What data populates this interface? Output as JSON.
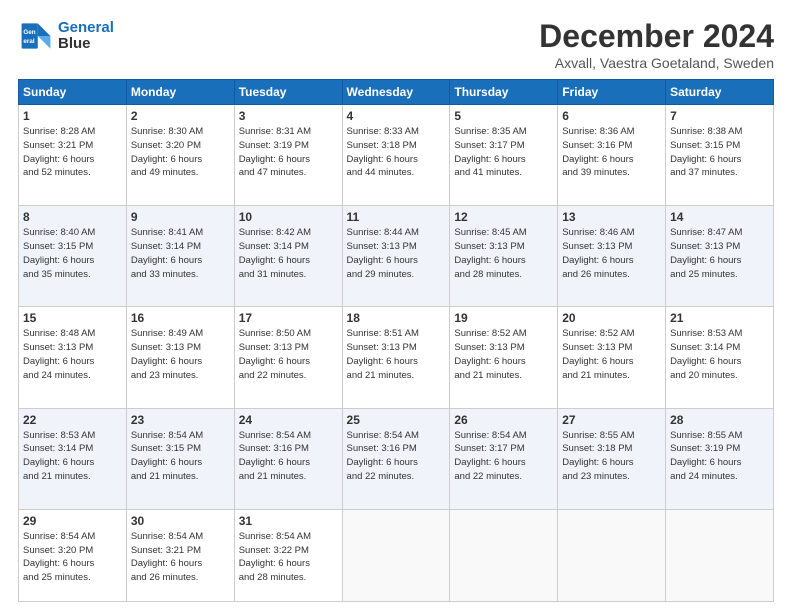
{
  "header": {
    "logo_line1": "General",
    "logo_line2": "Blue",
    "title": "December 2024",
    "subtitle": "Axvall, Vaestra Goetaland, Sweden"
  },
  "weekdays": [
    "Sunday",
    "Monday",
    "Tuesday",
    "Wednesday",
    "Thursday",
    "Friday",
    "Saturday"
  ],
  "weeks": [
    [
      {
        "day": "1",
        "lines": [
          "Sunrise: 8:28 AM",
          "Sunset: 3:21 PM",
          "Daylight: 6 hours",
          "and 52 minutes."
        ]
      },
      {
        "day": "2",
        "lines": [
          "Sunrise: 8:30 AM",
          "Sunset: 3:20 PM",
          "Daylight: 6 hours",
          "and 49 minutes."
        ]
      },
      {
        "day": "3",
        "lines": [
          "Sunrise: 8:31 AM",
          "Sunset: 3:19 PM",
          "Daylight: 6 hours",
          "and 47 minutes."
        ]
      },
      {
        "day": "4",
        "lines": [
          "Sunrise: 8:33 AM",
          "Sunset: 3:18 PM",
          "Daylight: 6 hours",
          "and 44 minutes."
        ]
      },
      {
        "day": "5",
        "lines": [
          "Sunrise: 8:35 AM",
          "Sunset: 3:17 PM",
          "Daylight: 6 hours",
          "and 41 minutes."
        ]
      },
      {
        "day": "6",
        "lines": [
          "Sunrise: 8:36 AM",
          "Sunset: 3:16 PM",
          "Daylight: 6 hours",
          "and 39 minutes."
        ]
      },
      {
        "day": "7",
        "lines": [
          "Sunrise: 8:38 AM",
          "Sunset: 3:15 PM",
          "Daylight: 6 hours",
          "and 37 minutes."
        ]
      }
    ],
    [
      {
        "day": "8",
        "lines": [
          "Sunrise: 8:40 AM",
          "Sunset: 3:15 PM",
          "Daylight: 6 hours",
          "and 35 minutes."
        ]
      },
      {
        "day": "9",
        "lines": [
          "Sunrise: 8:41 AM",
          "Sunset: 3:14 PM",
          "Daylight: 6 hours",
          "and 33 minutes."
        ]
      },
      {
        "day": "10",
        "lines": [
          "Sunrise: 8:42 AM",
          "Sunset: 3:14 PM",
          "Daylight: 6 hours",
          "and 31 minutes."
        ]
      },
      {
        "day": "11",
        "lines": [
          "Sunrise: 8:44 AM",
          "Sunset: 3:13 PM",
          "Daylight: 6 hours",
          "and 29 minutes."
        ]
      },
      {
        "day": "12",
        "lines": [
          "Sunrise: 8:45 AM",
          "Sunset: 3:13 PM",
          "Daylight: 6 hours",
          "and 28 minutes."
        ]
      },
      {
        "day": "13",
        "lines": [
          "Sunrise: 8:46 AM",
          "Sunset: 3:13 PM",
          "Daylight: 6 hours",
          "and 26 minutes."
        ]
      },
      {
        "day": "14",
        "lines": [
          "Sunrise: 8:47 AM",
          "Sunset: 3:13 PM",
          "Daylight: 6 hours",
          "and 25 minutes."
        ]
      }
    ],
    [
      {
        "day": "15",
        "lines": [
          "Sunrise: 8:48 AM",
          "Sunset: 3:13 PM",
          "Daylight: 6 hours",
          "and 24 minutes."
        ]
      },
      {
        "day": "16",
        "lines": [
          "Sunrise: 8:49 AM",
          "Sunset: 3:13 PM",
          "Daylight: 6 hours",
          "and 23 minutes."
        ]
      },
      {
        "day": "17",
        "lines": [
          "Sunrise: 8:50 AM",
          "Sunset: 3:13 PM",
          "Daylight: 6 hours",
          "and 22 minutes."
        ]
      },
      {
        "day": "18",
        "lines": [
          "Sunrise: 8:51 AM",
          "Sunset: 3:13 PM",
          "Daylight: 6 hours",
          "and 21 minutes."
        ]
      },
      {
        "day": "19",
        "lines": [
          "Sunrise: 8:52 AM",
          "Sunset: 3:13 PM",
          "Daylight: 6 hours",
          "and 21 minutes."
        ]
      },
      {
        "day": "20",
        "lines": [
          "Sunrise: 8:52 AM",
          "Sunset: 3:13 PM",
          "Daylight: 6 hours",
          "and 21 minutes."
        ]
      },
      {
        "day": "21",
        "lines": [
          "Sunrise: 8:53 AM",
          "Sunset: 3:14 PM",
          "Daylight: 6 hours",
          "and 20 minutes."
        ]
      }
    ],
    [
      {
        "day": "22",
        "lines": [
          "Sunrise: 8:53 AM",
          "Sunset: 3:14 PM",
          "Daylight: 6 hours",
          "and 21 minutes."
        ]
      },
      {
        "day": "23",
        "lines": [
          "Sunrise: 8:54 AM",
          "Sunset: 3:15 PM",
          "Daylight: 6 hours",
          "and 21 minutes."
        ]
      },
      {
        "day": "24",
        "lines": [
          "Sunrise: 8:54 AM",
          "Sunset: 3:16 PM",
          "Daylight: 6 hours",
          "and 21 minutes."
        ]
      },
      {
        "day": "25",
        "lines": [
          "Sunrise: 8:54 AM",
          "Sunset: 3:16 PM",
          "Daylight: 6 hours",
          "and 22 minutes."
        ]
      },
      {
        "day": "26",
        "lines": [
          "Sunrise: 8:54 AM",
          "Sunset: 3:17 PM",
          "Daylight: 6 hours",
          "and 22 minutes."
        ]
      },
      {
        "day": "27",
        "lines": [
          "Sunrise: 8:55 AM",
          "Sunset: 3:18 PM",
          "Daylight: 6 hours",
          "and 23 minutes."
        ]
      },
      {
        "day": "28",
        "lines": [
          "Sunrise: 8:55 AM",
          "Sunset: 3:19 PM",
          "Daylight: 6 hours",
          "and 24 minutes."
        ]
      }
    ],
    [
      {
        "day": "29",
        "lines": [
          "Sunrise: 8:54 AM",
          "Sunset: 3:20 PM",
          "Daylight: 6 hours",
          "and 25 minutes."
        ]
      },
      {
        "day": "30",
        "lines": [
          "Sunrise: 8:54 AM",
          "Sunset: 3:21 PM",
          "Daylight: 6 hours",
          "and 26 minutes."
        ]
      },
      {
        "day": "31",
        "lines": [
          "Sunrise: 8:54 AM",
          "Sunset: 3:22 PM",
          "Daylight: 6 hours",
          "and 28 minutes."
        ]
      },
      null,
      null,
      null,
      null
    ]
  ]
}
